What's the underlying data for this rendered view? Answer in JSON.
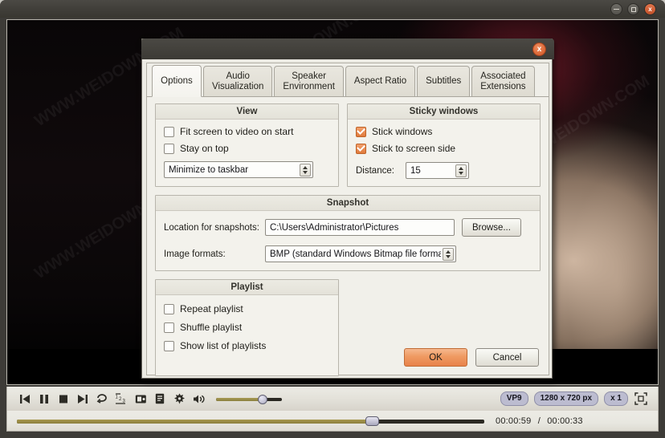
{
  "window": {
    "minimize_label": "Minimize",
    "maximize_label": "Maximize",
    "close_label": "x"
  },
  "dialog": {
    "close_label": "x",
    "tabs": [
      {
        "label": "Options",
        "active": true
      },
      {
        "label": "Audio Visualization",
        "line1": "Audio",
        "line2": "Visualization",
        "active": false
      },
      {
        "label": "Speaker Environment",
        "line1": "Speaker",
        "line2": "Environment",
        "active": false
      },
      {
        "label": "Aspect Ratio",
        "active": false
      },
      {
        "label": "Subtitles",
        "active": false
      },
      {
        "label": "Associated Extensions",
        "line1": "Associated",
        "line2": "Extensions",
        "active": false
      }
    ],
    "view": {
      "title": "View",
      "fit_screen_label": "Fit screen to video on start",
      "fit_screen_checked": false,
      "stay_on_top_label": "Stay on top",
      "stay_on_top_checked": false,
      "minimize_combo_value": "Minimize to taskbar"
    },
    "sticky": {
      "title": "Sticky windows",
      "stick_windows_label": "Stick windows",
      "stick_windows_checked": true,
      "stick_screen_side_label": "Stick to screen side",
      "stick_screen_side_checked": true,
      "distance_label": "Distance:",
      "distance_value": "15"
    },
    "snapshot": {
      "title": "Snapshot",
      "location_label": "Location for snapshots:",
      "location_value": "C:\\Users\\Administrator\\Pictures",
      "browse_label": "Browse...",
      "formats_label": "Image formats:",
      "formats_value": "BMP (standard Windows Bitmap file format)"
    },
    "playlist": {
      "title": "Playlist",
      "repeat_label": "Repeat playlist",
      "repeat_checked": false,
      "shuffle_label": "Shuffle playlist",
      "shuffle_checked": false,
      "show_list_label": "Show list of playlists",
      "show_list_checked": false
    },
    "ok_label": "OK",
    "cancel_label": "Cancel"
  },
  "controls": {
    "icons": [
      "previous-icon",
      "pause-icon",
      "stop-icon",
      "next-icon",
      "repeat-icon",
      "playlist-order-icon",
      "snapshot-icon",
      "playlist-icon",
      "settings-icon",
      "volume-icon"
    ],
    "badges": {
      "codec": "VP9",
      "resolution": "1280 x 720 px",
      "speed": "x 1"
    },
    "fullscreen_icon": "fullscreen-icon",
    "volume_percent": 68
  },
  "seek": {
    "current_time": "00:00:59",
    "separator": "/",
    "total_time": "00:00:33",
    "progress_percent": 75
  },
  "watermark": {
    "text": "WWW.WEIDOWN.COM"
  },
  "colors": {
    "accent_orange": "#e8824a",
    "titlebar": "#403e39",
    "panel_bg": "#f1f0ea",
    "slider_fill": "#8c803c"
  }
}
